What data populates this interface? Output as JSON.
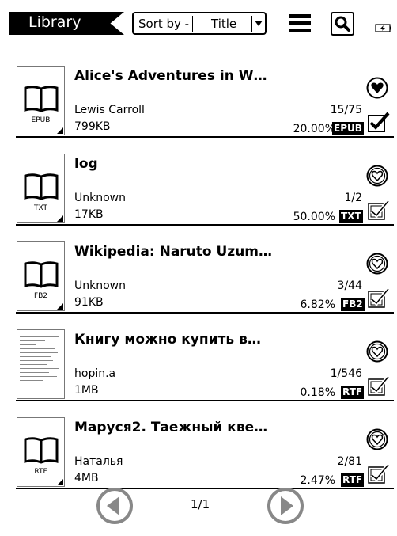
{
  "header": {
    "library_label": "Library",
    "sort_label": "Sort by -",
    "sort_value": "Title"
  },
  "books": [
    {
      "title": "Alice's Adventures in W…",
      "author": "Lewis Carroll",
      "size": "799KB",
      "pages": "15/75",
      "percent": "20.00%",
      "format": "EPUB",
      "cover_label": "EPUB",
      "favorite": true,
      "selected": true
    },
    {
      "title": "log",
      "author": "Unknown",
      "size": "17KB",
      "pages": "1/2",
      "percent": "50.00%",
      "format": "TXT",
      "cover_label": "TXT",
      "favorite": false,
      "selected": false
    },
    {
      "title": "Wikipedia: Naruto Uzum…",
      "author": "Unknown",
      "size": "91KB",
      "pages": "3/44",
      "percent": "6.82%",
      "format": "FB2",
      "cover_label": "FB2",
      "favorite": false,
      "selected": false
    },
    {
      "title": "Книгу можно купить в…",
      "author": "hopin.a",
      "size": "1MB",
      "pages": "1/546",
      "percent": "0.18%",
      "format": "RTF",
      "cover_label": "",
      "favorite": false,
      "selected": false
    },
    {
      "title": "Маруся2. Таежный кве…",
      "author": "Наталья",
      "size": "4MB",
      "pages": "2/81",
      "percent": "2.47%",
      "format": "RTF",
      "cover_label": "RTF",
      "favorite": false,
      "selected": false
    }
  ],
  "pager": {
    "page_indicator": "1/1"
  }
}
